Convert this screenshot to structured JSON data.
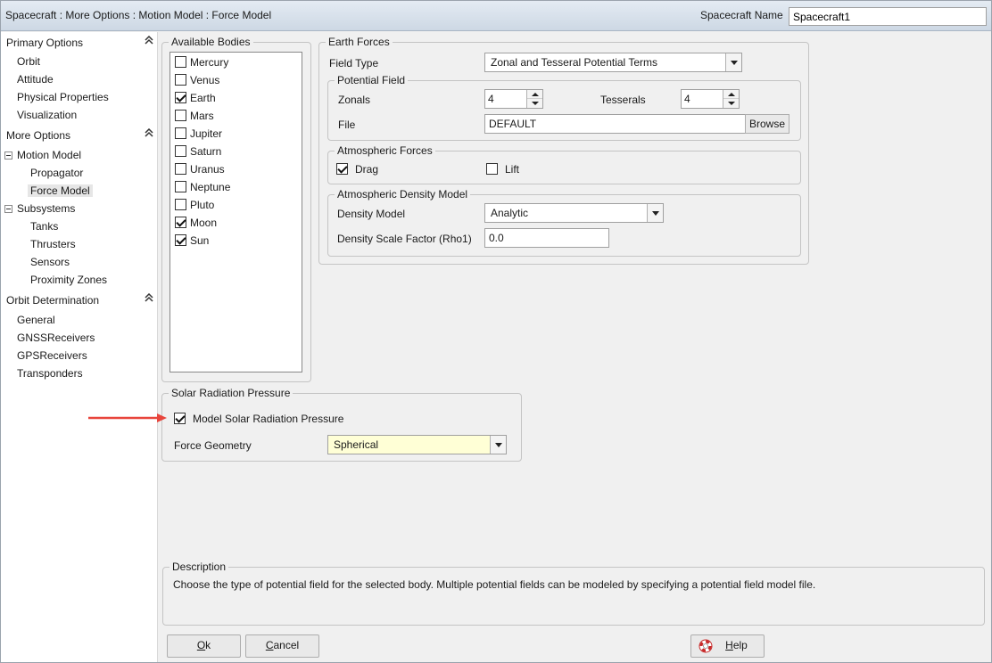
{
  "header": {
    "path": "Spacecraft : More Options : Motion Model : Force Model",
    "spacecraft_name_label": "Spacecraft Name",
    "spacecraft_name_value": "Spacecraft1"
  },
  "nav": {
    "primary_options": "Primary Options",
    "orbit": "Orbit",
    "attitude": "Attitude",
    "physical_properties": "Physical Properties",
    "visualization": "Visualization",
    "more_options": "More Options",
    "motion_model": "Motion Model",
    "propagator": "Propagator",
    "force_model": "Force Model",
    "subsystems": "Subsystems",
    "tanks": "Tanks",
    "thrusters": "Thrusters",
    "sensors": "Sensors",
    "proximity_zones": "Proximity Zones",
    "orbit_determination": "Orbit Determination",
    "general": "General",
    "gnss_receivers": "GNSSReceivers",
    "gps_receivers": "GPSReceivers",
    "transponders": "Transponders",
    "collapse_glyph": "»"
  },
  "available_bodies": {
    "title": "Available Bodies",
    "items": [
      {
        "name": "Mercury",
        "checked": false
      },
      {
        "name": "Venus",
        "checked": false
      },
      {
        "name": "Earth",
        "checked": true
      },
      {
        "name": "Mars",
        "checked": false
      },
      {
        "name": "Jupiter",
        "checked": false
      },
      {
        "name": "Saturn",
        "checked": false
      },
      {
        "name": "Uranus",
        "checked": false
      },
      {
        "name": "Neptune",
        "checked": false
      },
      {
        "name": "Pluto",
        "checked": false
      },
      {
        "name": "Moon",
        "checked": true
      },
      {
        "name": "Sun",
        "checked": true
      }
    ]
  },
  "earth_forces": {
    "title": "Earth Forces",
    "field_type_label": "Field Type",
    "field_type_value": "Zonal and Tesseral Potential Terms",
    "potential_field": {
      "title": "Potential Field",
      "zonals_label": "Zonals",
      "zonals_value": "4",
      "tesserals_label": "Tesserals",
      "tesserals_value": "4",
      "file_label": "File",
      "file_value": "DEFAULT",
      "browse_label": "Browse"
    },
    "atmospheric_forces": {
      "title": "Atmospheric Forces",
      "drag_label": "Drag",
      "drag_checked": true,
      "lift_label": "Lift",
      "lift_checked": false
    },
    "atmospheric_density_model": {
      "title": "Atmospheric Density Model",
      "density_model_label": "Density Model",
      "density_model_value": "Analytic",
      "density_scale_label": "Density Scale Factor (Rho1)",
      "density_scale_value": "0.0"
    }
  },
  "solar_radiation": {
    "title": "Solar Radiation Pressure",
    "model_label": "Model Solar Radiation Pressure",
    "model_checked": true,
    "force_geometry_label": "Force Geometry",
    "force_geometry_value": "Spherical"
  },
  "description": {
    "title": "Description",
    "text": "Choose the type of potential field for the selected body.  Multiple potential fields can be modeled by specifying a potential field model file."
  },
  "buttons": {
    "ok_accel": "O",
    "ok_rest": "k",
    "cancel_accel": "C",
    "cancel_rest": "ancel",
    "help_accel": "H",
    "help_rest": "elp"
  },
  "colors": {
    "highlight_field": "#ffffd6",
    "annotation_arrow": "#e8453c"
  }
}
